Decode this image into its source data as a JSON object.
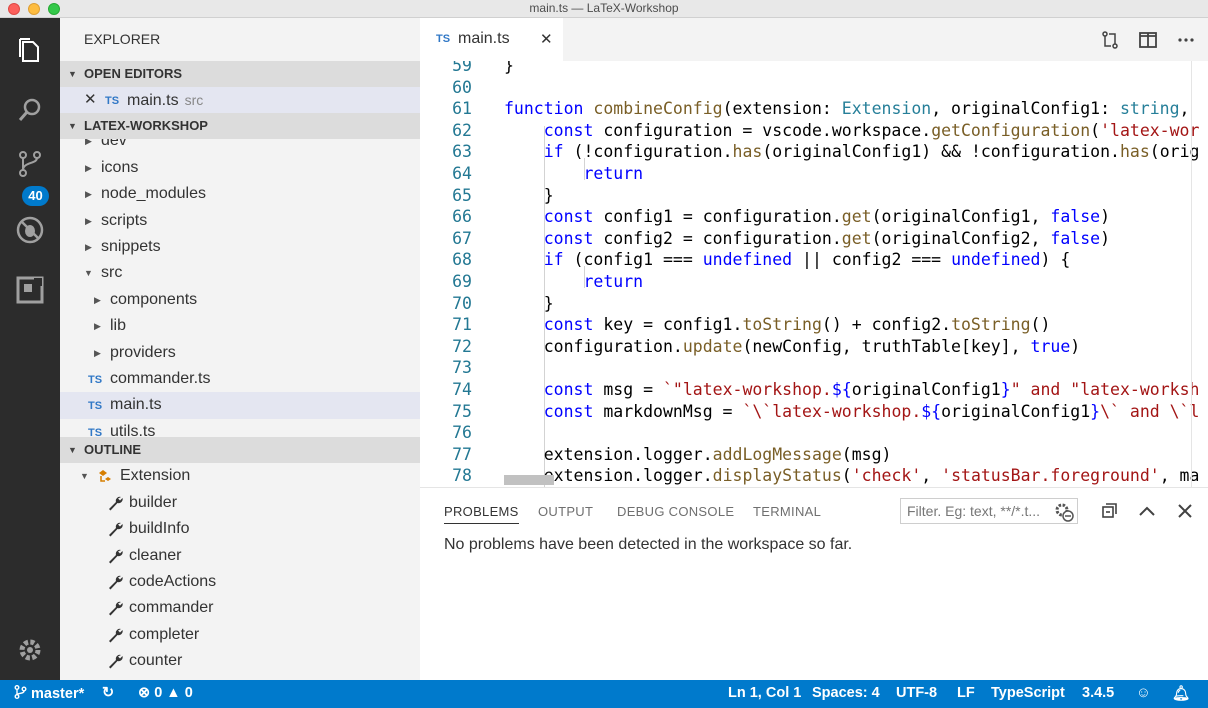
{
  "window": {
    "title": "main.ts — LaTeX-Workshop"
  },
  "activity_bar": {
    "items": [
      {
        "icon": "files-icon"
      },
      {
        "icon": "search-icon"
      },
      {
        "icon": "source-control-icon",
        "badge": "40"
      },
      {
        "icon": "debug-icon"
      },
      {
        "icon": "extensions-icon"
      }
    ],
    "settings_icon": "gear-icon"
  },
  "sidebar": {
    "title": "EXPLORER",
    "open_editors": {
      "header": "OPEN EDITORS",
      "items": [
        {
          "type": "TS",
          "name": "main.ts",
          "desc": "src"
        }
      ]
    },
    "workspace": {
      "header": "LATEX-WORKSHOP",
      "items": [
        {
          "label": "dev"
        },
        {
          "label": "icons"
        },
        {
          "label": "node_modules"
        },
        {
          "label": "scripts"
        },
        {
          "label": "snippets"
        },
        {
          "label": "src"
        },
        {
          "label": "components"
        },
        {
          "label": "lib"
        },
        {
          "label": "providers"
        },
        {
          "label": "commander.ts",
          "type": "TS"
        },
        {
          "label": "main.ts",
          "type": "TS"
        },
        {
          "label": "utils.ts",
          "type": "TS"
        }
      ]
    },
    "outline": {
      "header": "OUTLINE",
      "root": "Extension",
      "items": [
        "builder",
        "buildInfo",
        "cleaner",
        "codeActions",
        "commander",
        "completer",
        "counter"
      ]
    }
  },
  "editor": {
    "tab": {
      "type": "TS",
      "name": "main.ts"
    },
    "lines": [
      {
        "n": "59"
      },
      {
        "n": "60"
      },
      {
        "n": "61"
      },
      {
        "n": "62"
      },
      {
        "n": "63"
      },
      {
        "n": "64"
      },
      {
        "n": "65"
      },
      {
        "n": "66"
      },
      {
        "n": "67"
      },
      {
        "n": "68"
      },
      {
        "n": "69"
      },
      {
        "n": "70"
      },
      {
        "n": "71"
      },
      {
        "n": "72"
      },
      {
        "n": "73"
      },
      {
        "n": "74"
      },
      {
        "n": "75"
      },
      {
        "n": "76"
      },
      {
        "n": "77"
      },
      {
        "n": "78"
      }
    ],
    "code": {
      "l59": "}",
      "l61a": "function",
      "l61b": "combineConfig",
      "l61c": "(extension: ",
      "l61d": "Extension",
      "l61e": ", originalConfig1: ",
      "l61f": "string",
      "l61g": ",",
      "l62a": "const",
      "l62b": " configuration = vscode.workspace.",
      "l62c": "getConfiguration",
      "l62d": "(",
      "l62e": "'latex-wor",
      "l63a": "if",
      "l63b": " (!configuration.",
      "l63c": "has",
      "l63d": "(originalConfig1) && !configuration.",
      "l63e": "has",
      "l63f": "(orig",
      "l64": "return",
      "l65": "}",
      "l66a": "const",
      "l66b": " config1 = configuration.",
      "l66c": "get",
      "l66d": "(originalConfig1, ",
      "l66e": "false",
      "l66f": ")",
      "l67a": "const",
      "l67b": " config2 = configuration.",
      "l67c": "get",
      "l67d": "(originalConfig2, ",
      "l67e": "false",
      "l67f": ")",
      "l68a": "if",
      "l68b": " (config1 === ",
      "l68c": "undefined",
      "l68d": " || config2 === ",
      "l68e": "undefined",
      "l68f": ") {",
      "l69": "return",
      "l70": "}",
      "l71a": "const",
      "l71b": " key = config1.",
      "l71c": "toString",
      "l71d": "() + config2.",
      "l71e": "toString",
      "l71f": "()",
      "l72a": "configuration.",
      "l72b": "update",
      "l72c": "(newConfig, truthTable[key], ",
      "l72d": "true",
      "l72e": ")",
      "l74a": "const",
      "l74b": " msg = ",
      "l74c": "`\"latex-workshop.",
      "l74d": "${",
      "l74e": "originalConfig1",
      "l74f": "}",
      "l74g": "\" and \"latex-worksh",
      "l75a": "const",
      "l75b": " markdownMsg = ",
      "l75c": "`\\`latex-workshop.",
      "l75d": "${",
      "l75e": "originalConfig1",
      "l75f": "}",
      "l75g": "\\` and \\`l",
      "l77a": "extension.logger.",
      "l77b": "addLogMessage",
      "l77c": "(msg)",
      "l78a": "extension.logger.",
      "l78b": "displayStatus",
      "l78c": "(",
      "l78d": "'check'",
      "l78e": ", ",
      "l78f": "'statusBar.foreground'",
      "l78g": ", ma"
    }
  },
  "panel": {
    "tabs": [
      "PROBLEMS",
      "OUTPUT",
      "DEBUG CONSOLE",
      "TERMINAL"
    ],
    "active_tab": "PROBLEMS",
    "filter_placeholder": "Filter. Eg: text, **/*.t...",
    "message": "No problems have been detected in the workspace so far."
  },
  "status_bar": {
    "branch": "master*",
    "errors": "0",
    "warnings": "0",
    "position": "Ln 1, Col 1",
    "spaces": "Spaces: 4",
    "encoding": "UTF-8",
    "eol": "LF",
    "language": "TypeScript",
    "version": "3.4.5"
  },
  "colors": {
    "status_bar": "#007acc",
    "activity_bar": "#2c2c2c",
    "sidebar": "#f3f3f3",
    "keyword": "#0000ff",
    "function": "#795e26",
    "string": "#a31515",
    "type": "#267f99",
    "line_number": "#237893"
  }
}
